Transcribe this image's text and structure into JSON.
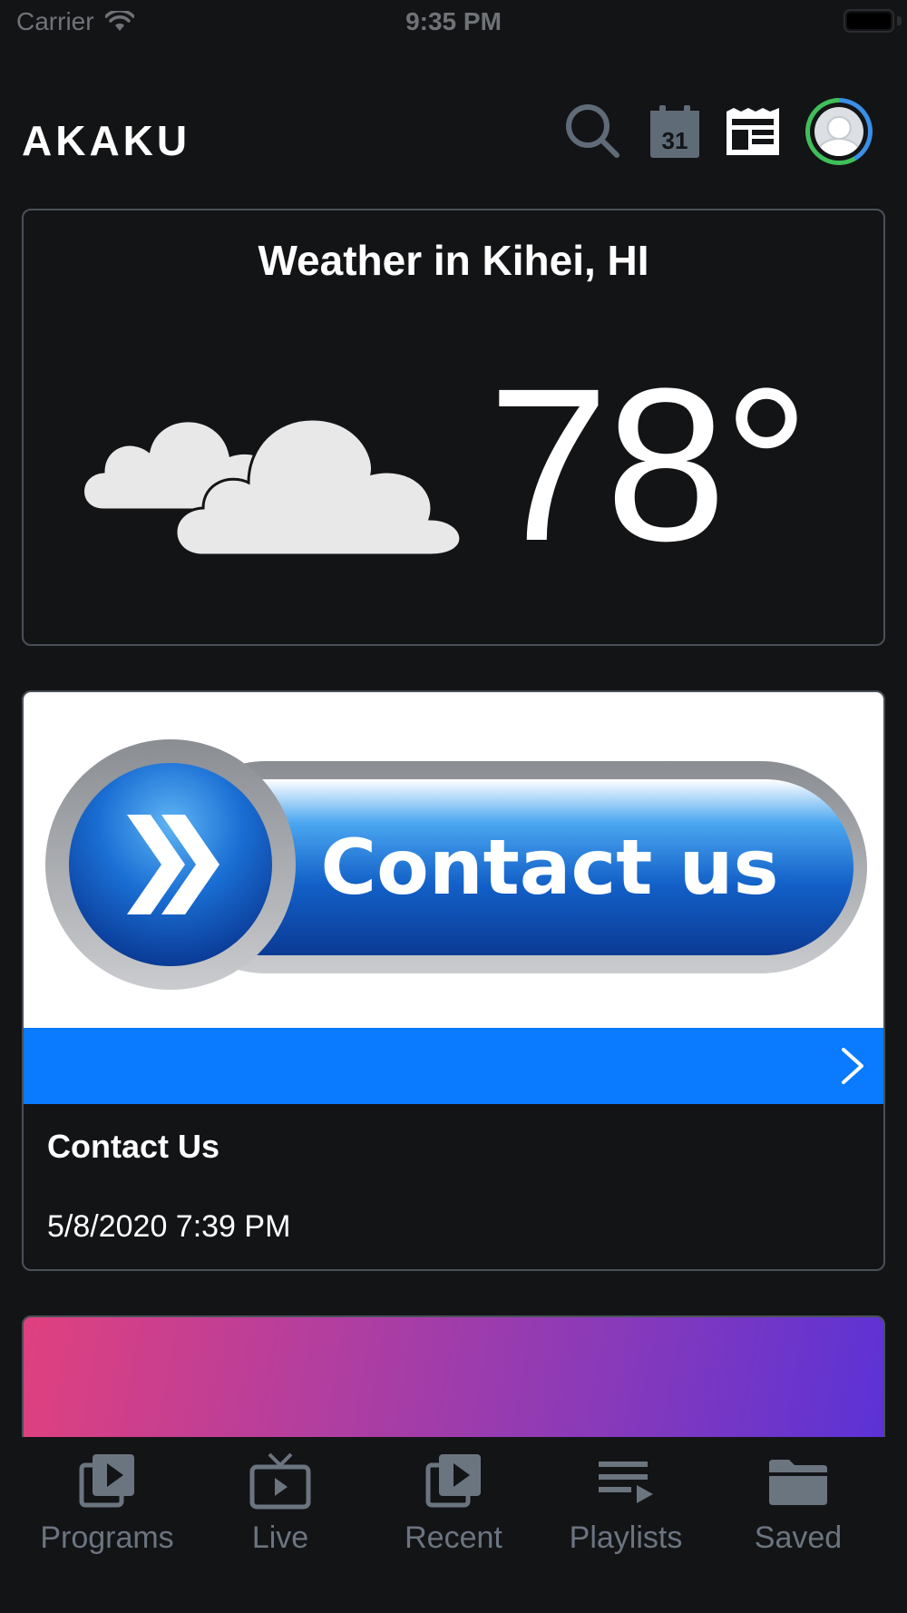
{
  "status_bar": {
    "carrier": "Carrier",
    "time": "9:35 PM"
  },
  "header": {
    "title": "AKAKU",
    "icons": [
      "search-icon",
      "calendar-icon",
      "news-icon",
      "avatar"
    ],
    "calendar_day": "31"
  },
  "weather": {
    "title": "Weather in Kihei, HI",
    "temperature": "78°",
    "condition_icon": "cloudy-icon"
  },
  "contact_card": {
    "image_label": "Contact us",
    "title": "Contact Us",
    "date": "5/8/2020 7:39 PM",
    "accent_color": "#0a7aff"
  },
  "tab_bar": {
    "tabs": [
      {
        "label": "Programs",
        "icon": "programs-icon"
      },
      {
        "label": "Live",
        "icon": "live-tv-icon"
      },
      {
        "label": "Recent",
        "icon": "recent-icon"
      },
      {
        "label": "Playlists",
        "icon": "playlist-icon"
      },
      {
        "label": "Saved",
        "icon": "folder-icon"
      }
    ],
    "inactive_color": "#6b7580"
  }
}
